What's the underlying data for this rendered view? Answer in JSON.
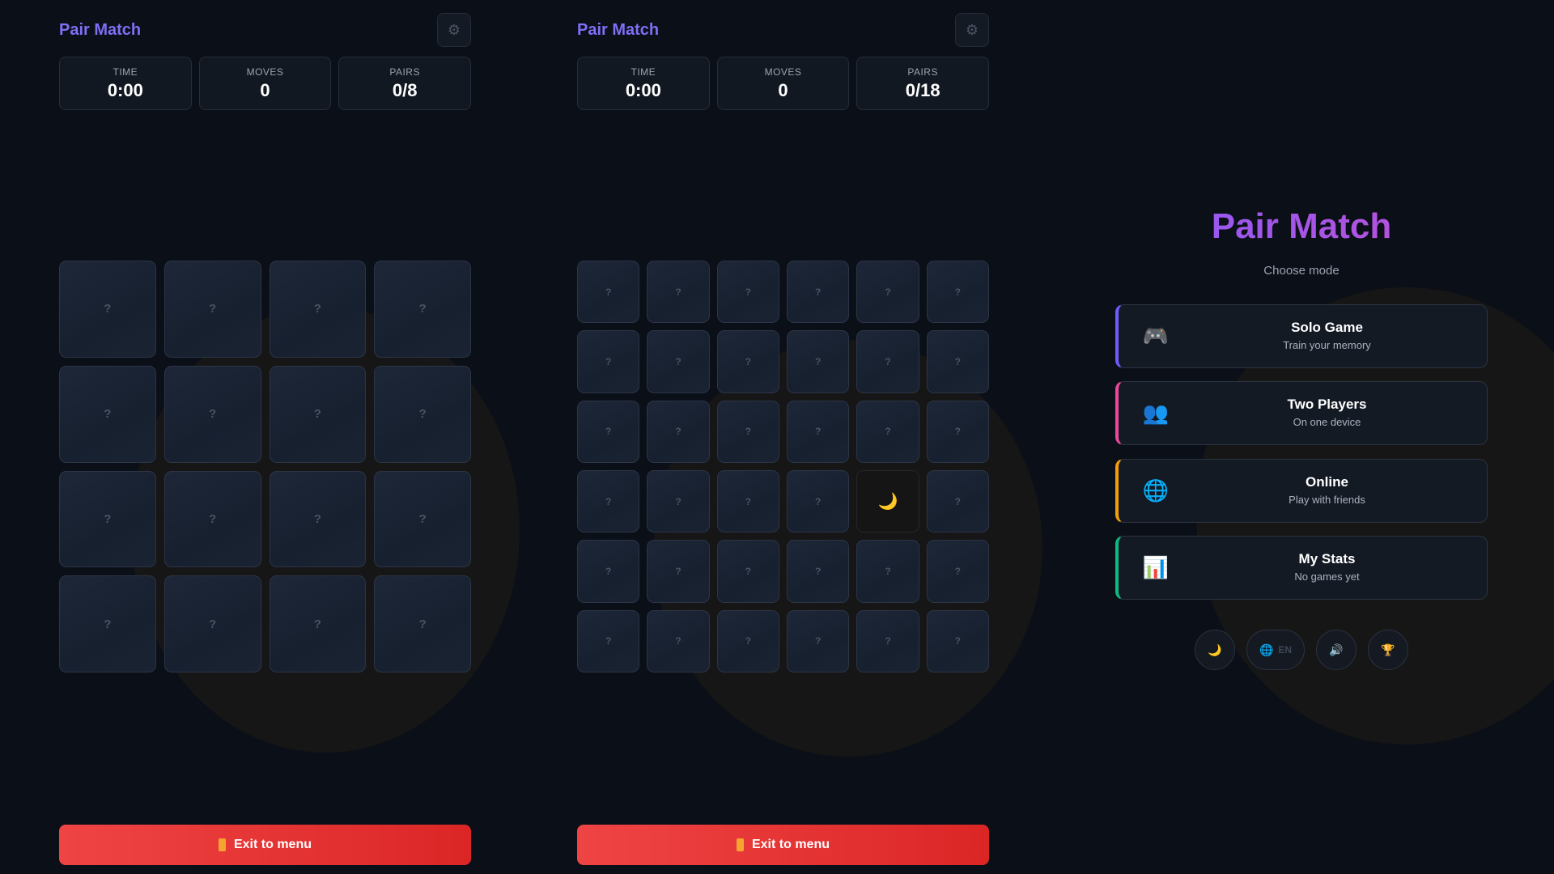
{
  "panels": [
    {
      "title": "Pair Match",
      "settings_icon": "gear-icon",
      "stats": {
        "time_label": "TIME",
        "time_value": "0:00",
        "moves_label": "MOVES",
        "moves_value": "0",
        "pairs_label": "PAIRS",
        "pairs_value": "0/8"
      },
      "grid_size": 4,
      "card_back": "?",
      "flipped_cards": [],
      "exit_label": "Exit to menu"
    },
    {
      "title": "Pair Match",
      "settings_icon": "gear-icon",
      "stats": {
        "time_label": "TIME",
        "time_value": "0:00",
        "moves_label": "MOVES",
        "moves_value": "0",
        "pairs_label": "PAIRS",
        "pairs_value": "0/18"
      },
      "grid_size": 6,
      "card_back": "?",
      "flipped_cards": [
        {
          "index": 22,
          "symbol": "🌙"
        }
      ],
      "exit_label": "Exit to menu"
    }
  ],
  "menu": {
    "title": "Pair Match",
    "subtitle": "Choose mode",
    "modes": [
      {
        "name": "Solo Game",
        "desc": "Train your memory",
        "icon": "🎮",
        "accent": "#6d5dfc"
      },
      {
        "name": "Two Players",
        "desc": "On one device",
        "icon": "👥",
        "accent": "#ec4899"
      },
      {
        "name": "Online",
        "desc": "Play with friends",
        "icon": "🌐",
        "accent": "#f59e0b"
      },
      {
        "name": "My Stats",
        "desc": "No games yet",
        "icon": "📊",
        "accent": "#10b981"
      }
    ],
    "bottom": {
      "theme_icon": "🌙",
      "language_icon": "🌐",
      "language_code": "EN",
      "sound_icon": "🔊",
      "trophy_icon": "🏆"
    }
  },
  "colors": {
    "background": "#0b0f17",
    "title_accent": "#7e6ff5",
    "exit_red": "#ef4444"
  }
}
